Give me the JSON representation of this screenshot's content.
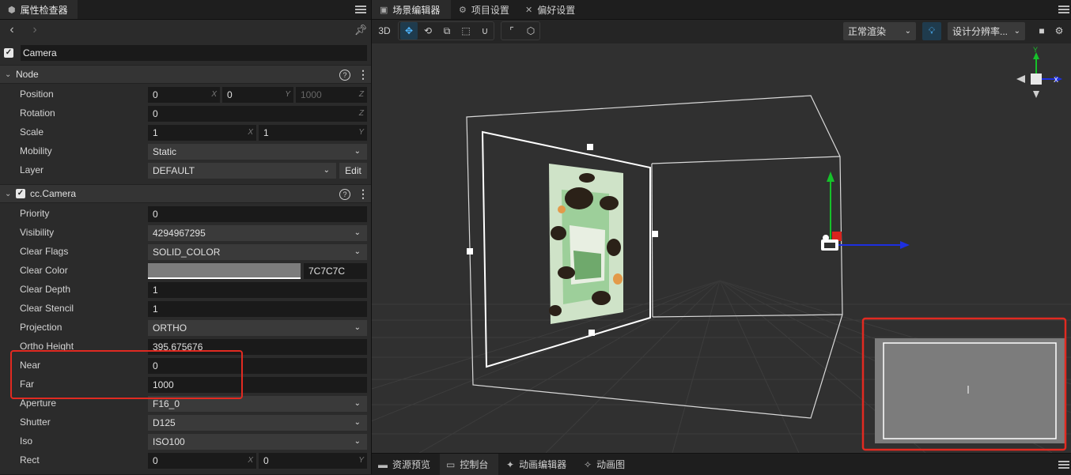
{
  "inspector": {
    "tab_title": "属性检查器",
    "node_name": "Camera",
    "node_section": {
      "title": "Node",
      "position": {
        "label": "Position",
        "x": "0",
        "y": "0",
        "z": "1000"
      },
      "rotation": {
        "label": "Rotation",
        "value": "0",
        "axis": "Z"
      },
      "scale": {
        "label": "Scale",
        "x": "1",
        "y": "1"
      },
      "mobility": {
        "label": "Mobility",
        "value": "Static"
      },
      "layer": {
        "label": "Layer",
        "value": "DEFAULT",
        "edit_label": "Edit"
      },
      "axis_x": "X",
      "axis_y": "Y",
      "axis_z": "Z"
    },
    "camera_section": {
      "title": "cc.Camera",
      "priority": {
        "label": "Priority",
        "value": "0"
      },
      "visibility": {
        "label": "Visibility",
        "value": "4294967295"
      },
      "clear_flags": {
        "label": "Clear Flags",
        "value": "SOLID_COLOR"
      },
      "clear_color": {
        "label": "Clear Color",
        "hex": "7C7C7C",
        "color": "#7c7c7c"
      },
      "clear_depth": {
        "label": "Clear Depth",
        "value": "1"
      },
      "clear_stencil": {
        "label": "Clear Stencil",
        "value": "1"
      },
      "projection": {
        "label": "Projection",
        "value": "ORTHO"
      },
      "ortho_height": {
        "label": "Ortho Height",
        "value": "395.675676"
      },
      "near": {
        "label": "Near",
        "value": "0"
      },
      "far": {
        "label": "Far",
        "value": "1000"
      },
      "aperture": {
        "label": "Aperture",
        "value": "F16_0"
      },
      "shutter": {
        "label": "Shutter",
        "value": "D125"
      },
      "iso": {
        "label": "Iso",
        "value": "ISO100"
      },
      "rect": {
        "label": "Rect",
        "x": "0",
        "y": "0"
      }
    }
  },
  "scene": {
    "tabs": [
      {
        "label": "场景编辑器",
        "icon": "scene-icon"
      },
      {
        "label": "项目设置",
        "icon": "gear-icon"
      },
      {
        "label": "偏好设置",
        "icon": "tools-icon"
      }
    ],
    "toolbar": {
      "mode_3d": "3D",
      "render_mode": "正常渲染",
      "resolution": "设计分辨率..."
    },
    "bottom_tabs": [
      {
        "label": "资源预览",
        "icon": "folder-icon"
      },
      {
        "label": "控制台",
        "icon": "console-icon"
      },
      {
        "label": "动画编辑器",
        "icon": "animation-icon"
      },
      {
        "label": "动画图",
        "icon": "animation-graph-icon"
      }
    ],
    "gizmo_axes": {
      "x": "X",
      "y": "Y"
    }
  },
  "colors": {
    "accent": "#4fb6ff",
    "highlight": "#e12a21",
    "clear_color": "#7c7c7c"
  }
}
